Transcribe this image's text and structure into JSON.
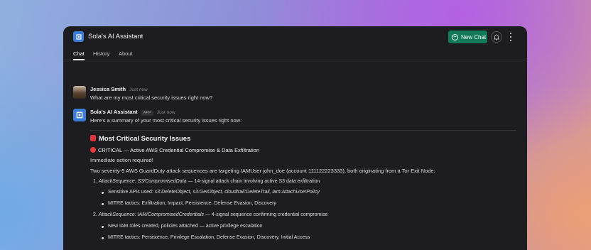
{
  "app": {
    "title": "Sola's AI Assistant",
    "new_chat_label": "New Chat",
    "accent_color": "#127a5a"
  },
  "tabs": [
    {
      "label": "Chat",
      "active": true
    },
    {
      "label": "History",
      "active": false
    },
    {
      "label": "About",
      "active": false
    }
  ],
  "user_message": {
    "author": "Jessica Smith",
    "time": "Just now",
    "text": "What are my most critical security issues right now?"
  },
  "assistant_message": {
    "author": "Sola's AI Assistant",
    "badge": "APP",
    "time": "Just now",
    "intro": "Here's a summary of your most critical security issues right now:",
    "heading": "Most Critical Security Issues",
    "critical_title": "CRITICAL — Active AWS Credential Compromise & Data Exfiltration",
    "action_line": "Immediate action required!",
    "summary": "Two severity-9 AWS GuardDuty attack sequences are targeting IAMUser john_doe (account 111122223333), both originating from a Tor Exit Node:",
    "items": [
      {
        "number": "1.",
        "name": "AttackSequence: S3/CompromisedData",
        "desc": " — 14-signal attack chain involving active S3 data exfiltration",
        "bullets": [
          {
            "prefix": "Sensitive APIs used: ",
            "apis": "s3:DeleteObject, s3:GetObject, cloudtrail:DeleteTrail, iam:AttachUserPolicy"
          },
          {
            "prefix": "MITRE tactics: Exfiltration, Impact, Persistence, Defense Evasion, Discovery",
            "apis": ""
          }
        ]
      },
      {
        "number": "2.",
        "name": "AttackSequence: IAM/CompromisedCredentials",
        "desc": " — 4-signal sequence confirming credential compromise",
        "bullets": [
          {
            "prefix": "New IAM roles created, policies attached — active privilege escalation",
            "apis": ""
          },
          {
            "prefix": "MITRE tactics: Persistence, Privilege Escalation, Defense Evasion, Discovery, Initial Access",
            "apis": ""
          }
        ]
      }
    ]
  }
}
